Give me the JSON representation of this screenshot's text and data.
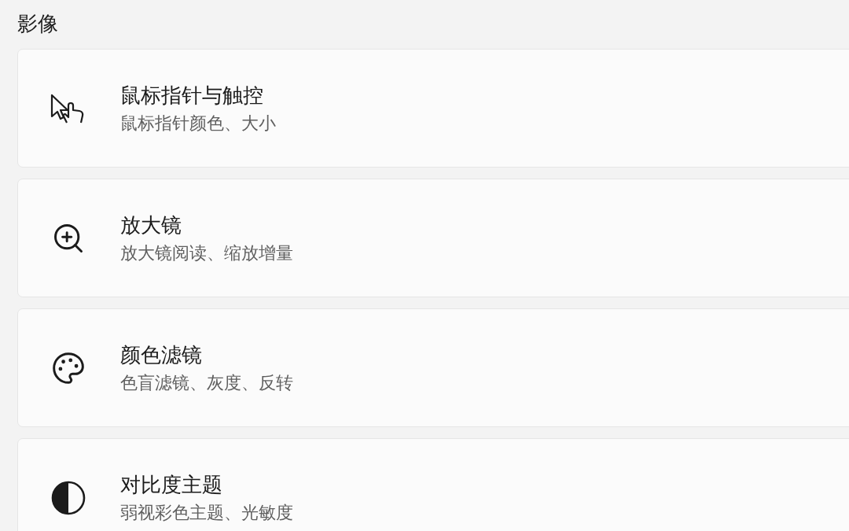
{
  "section": {
    "title": "影像"
  },
  "items": [
    {
      "title": "鼠标指针与触控",
      "subtitle": "鼠标指针颜色、大小"
    },
    {
      "title": "放大镜",
      "subtitle": "放大镜阅读、缩放增量"
    },
    {
      "title": "颜色滤镜",
      "subtitle": "色盲滤镜、灰度、反转"
    },
    {
      "title": "对比度主题",
      "subtitle": "弱视彩色主题、光敏度"
    }
  ]
}
